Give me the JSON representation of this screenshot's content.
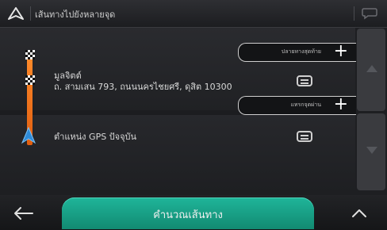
{
  "header": {
    "title": "เส้นทางไปยังหลายจุด",
    "nav_icon": "navigation-arrow-icon",
    "chat_icon": "speech-bubble-icon"
  },
  "route": {
    "add_destination_label": "ปลายทางสุดท้าย",
    "destination": {
      "name": "มูลจิตต์",
      "address": "ถ. สามเสน 793, ถนนนครไชยศรี, ดุสิต 10300"
    },
    "add_waypoint_label": "แทรกจุดผ่าน",
    "current_location": "ตำแหน่ง GPS ปัจจุบัน",
    "plus": "+"
  },
  "footer": {
    "calculate_label": "คำนวณเส้นทาง",
    "back_icon": "back-arrow-icon",
    "up_icon": "chevron-up-icon"
  },
  "colors": {
    "accent": "#1ba88e",
    "route_line": "#f07020",
    "gps_arrow": "#2e8bd8"
  }
}
